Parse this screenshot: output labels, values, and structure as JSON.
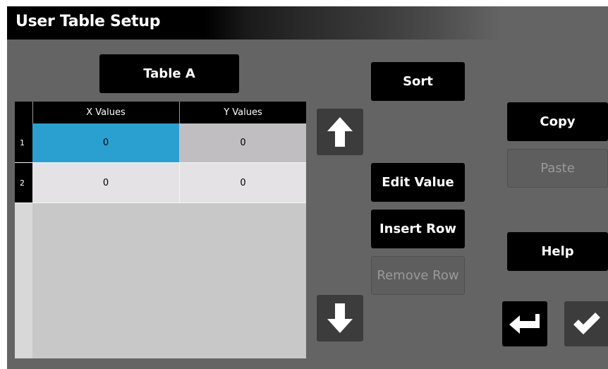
{
  "window": {
    "title": "User Table Setup"
  },
  "table_name_button": "Table A",
  "table": {
    "columns": [
      "X Values",
      "Y Values"
    ],
    "rows": [
      {
        "num": "1",
        "x": "0",
        "y": "0"
      },
      {
        "num": "2",
        "x": "0",
        "y": "0"
      }
    ],
    "selected_cell": {
      "row": 1,
      "column": "X Values"
    }
  },
  "buttons": {
    "sort": "Sort",
    "edit_value": "Edit Value",
    "insert_row": "Insert Row",
    "remove_row": "Remove Row",
    "copy": "Copy",
    "paste": "Paste",
    "help": "Help"
  },
  "icons": {
    "up": "arrow-up-icon",
    "down": "arrow-down-icon",
    "back": "return-arrow-icon",
    "confirm": "checkmark-icon"
  },
  "colors": {
    "background": "#646464",
    "button": "#000000",
    "selected_cell": "#2aa0d0",
    "disabled_text": "#9a9a9a"
  }
}
